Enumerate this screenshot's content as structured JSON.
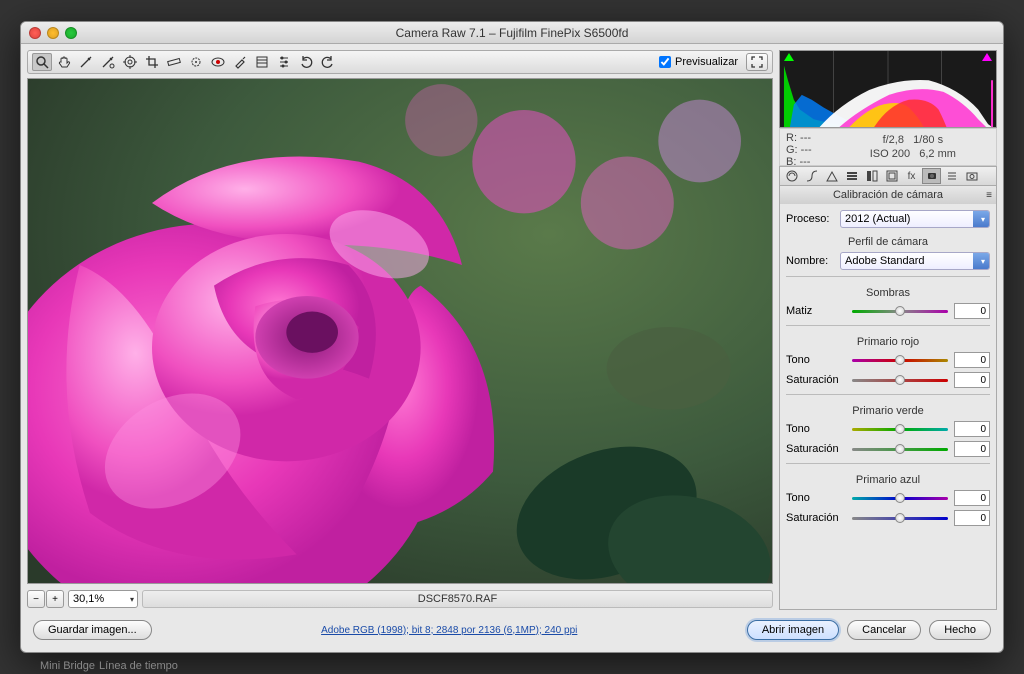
{
  "window": {
    "title": "Camera Raw 7.1  –  Fujifilm FinePix S6500fd"
  },
  "toolbar": {
    "preview_label": "Previsualizar"
  },
  "zoom": {
    "level": "30,1%"
  },
  "filename": "DSCF8570.RAF",
  "info": {
    "r": "R:   ---",
    "g": "G:   ---",
    "b": "B:   ---",
    "aperture": "f/2,8",
    "shutter": "1/80 s",
    "iso": "ISO 200",
    "focal": "6,2 mm"
  },
  "panel": {
    "title": "Calibración de cámara",
    "process_label": "Proceso:",
    "process_value": "2012 (Actual)",
    "profile_section": "Perfil de cámara",
    "name_label": "Nombre:",
    "name_value": "Adobe Standard",
    "shadows_section": "Sombras",
    "matiz_label": "Matiz",
    "red_section": "Primario rojo",
    "green_section": "Primario verde",
    "blue_section": "Primario azul",
    "tone_label": "Tono",
    "sat_label": "Saturación",
    "values": {
      "matiz": "0",
      "red_tone": "0",
      "red_sat": "0",
      "green_tone": "0",
      "green_sat": "0",
      "blue_tone": "0",
      "blue_sat": "0"
    }
  },
  "footer": {
    "save": "Guardar imagen...",
    "link": "Adobe RGB (1998); bit 8; 2848 por 2136 (6,1MP); 240 ppi",
    "open": "Abrir imagen",
    "cancel": "Cancelar",
    "done": "Hecho"
  },
  "bottom_tabs": {
    "mini_bridge": "Mini Bridge",
    "timeline": "Línea de tiempo"
  }
}
